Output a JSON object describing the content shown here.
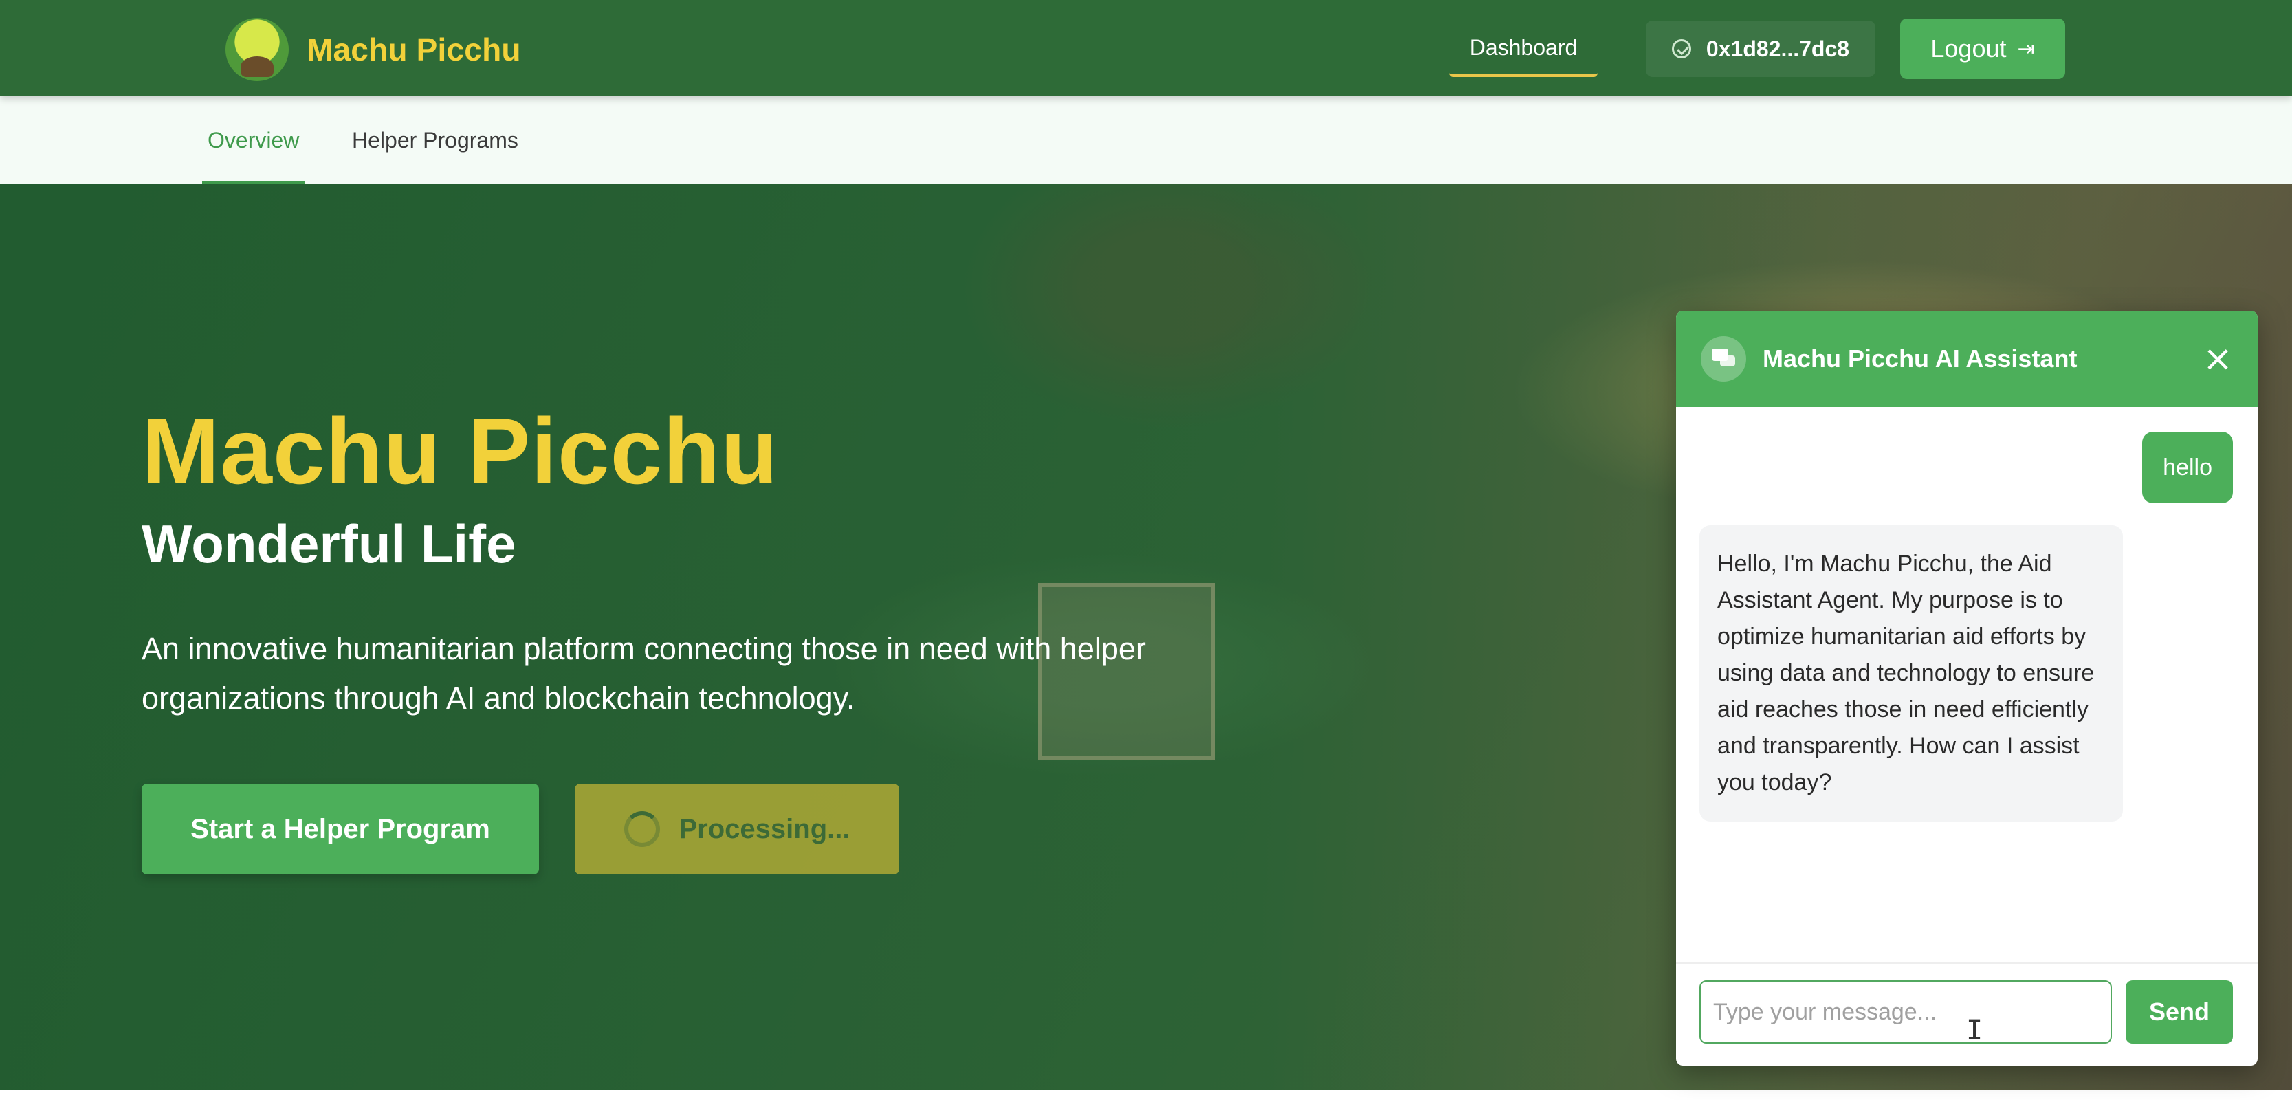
{
  "navbar": {
    "brand_name": "Machu Picchu",
    "dashboard_label": "Dashboard",
    "wallet_address": "0x1d82...7dc8",
    "logout_label": "Logout",
    "logout_icon": "logout-icon",
    "wallet_icon": "check-circle-icon"
  },
  "subnav": {
    "tabs": [
      {
        "label": "Overview",
        "active": true
      },
      {
        "label": "Helper Programs",
        "active": false
      }
    ]
  },
  "hero": {
    "title": "Machu Picchu",
    "subtitle": "Wonderful Life",
    "description": "An innovative humanitarian platform connecting those in need with helper organizations through AI and blockchain technology.",
    "primary_button": "Start a Helper Program",
    "secondary_button": "Processing..."
  },
  "chat": {
    "title": "Machu Picchu AI Assistant",
    "close_icon": "close-icon",
    "messages": [
      {
        "role": "user",
        "text": "hello"
      },
      {
        "role": "assistant",
        "text": "Hello, I'm Machu Picchu, the Aid Assistant Agent. My purpose is to optimize humanitarian aid efforts by using data and technology to ensure aid reaches those in need efficiently and transparently. How can I assist you today?"
      }
    ],
    "input_placeholder": "Type your message...",
    "input_value": "",
    "send_label": "Send"
  },
  "colors": {
    "navbar_bg": "#2e6b37",
    "brand_yellow": "#f2d13a",
    "accent_green": "#4caf5a",
    "processing_bg": "#bab036"
  }
}
